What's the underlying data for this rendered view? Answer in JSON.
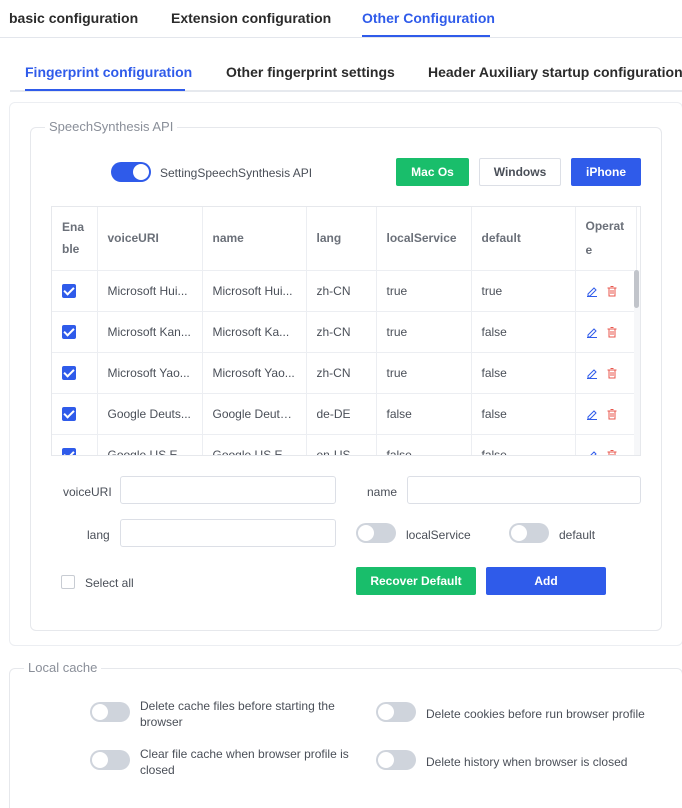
{
  "top_tabs": [
    "basic configuration",
    "Extension configuration",
    "Other Configuration"
  ],
  "sub_tabs": [
    "Fingerprint configuration",
    "Other fingerprint settings",
    "Header Auxiliary startup configuration"
  ],
  "speech": {
    "legend": "SpeechSynthesis API",
    "toggle_label": "SettingSpeechSynthesis API",
    "toggle_on": true,
    "presets": [
      "Mac Os",
      "Windows",
      "iPhone"
    ],
    "table": {
      "headers": [
        "Ena ble",
        "voiceURI",
        "name",
        "lang",
        "localService",
        "default",
        "Operat e"
      ],
      "rows": [
        {
          "voiceURI": "Microsoft Hui...",
          "name": "Microsoft Hui...",
          "lang": "zh-CN",
          "localService": "true",
          "default": "true"
        },
        {
          "voiceURI": "Microsoft Kan...",
          "name": "Microsoft Ka...",
          "lang": "zh-CN",
          "localService": "true",
          "default": "false"
        },
        {
          "voiceURI": "Microsoft Yao...",
          "name": "Microsoft Yao...",
          "lang": "zh-CN",
          "localService": "true",
          "default": "false"
        },
        {
          "voiceURI": "Google Deuts...",
          "name": "Google Deuts...",
          "lang": "de-DE",
          "localService": "false",
          "default": "false"
        },
        {
          "voiceURI": "Google US En...",
          "name": "Google US En...",
          "lang": "en-US",
          "localService": "false",
          "default": "false"
        }
      ]
    },
    "form": {
      "voiceURI_label": "voiceURI",
      "voiceURI_value": "",
      "name_label": "name",
      "name_value": "",
      "lang_label": "lang",
      "lang_value": "",
      "localService_label": "localService",
      "default_label": "default",
      "select_all_label": "Select all",
      "recover_default_label": "Recover Default",
      "add_label": "Add"
    }
  },
  "local_cache": {
    "legend": "Local cache",
    "options": [
      "Delete cache files before starting the browser",
      "Delete cookies before run browser profile",
      "Clear file cache when browser profile is closed",
      "Delete history when browser is closed"
    ]
  },
  "colors": {
    "accent": "#2f5bea",
    "green": "#19be6b",
    "delete": "#e8574d"
  },
  "icons": {
    "edit": "edit-icon",
    "delete": "trash-icon"
  }
}
